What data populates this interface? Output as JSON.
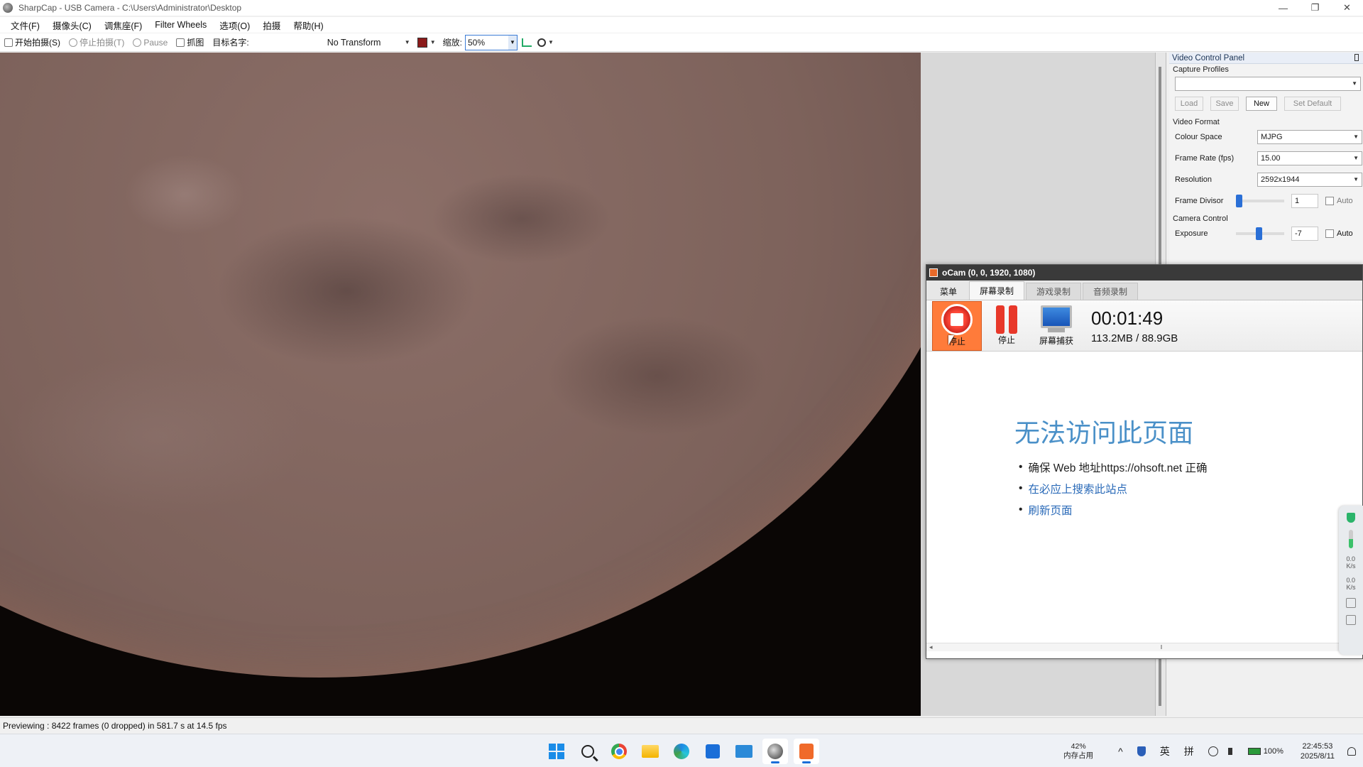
{
  "window": {
    "title": "SharpCap - USB Camera - C:\\Users\\Administrator\\Desktop",
    "controls": [
      "—",
      "❐",
      "✕"
    ]
  },
  "menu": [
    "文件(F)",
    "摄像头(C)",
    "调焦座(F)",
    "Filter Wheels",
    "选项(O)",
    "拍摄",
    "帮助(H)"
  ],
  "toolbar": {
    "start_capture": "开始拍摄(S)",
    "stop_capture": "停止拍摄(T)",
    "pause": "Pause",
    "snapshot": "抓图",
    "target_name": "目标名字:",
    "transform": "No Transform",
    "zoom_label": "缩放:",
    "zoom_value": "50%"
  },
  "video_control_panel": {
    "title": "Video Control Panel",
    "capture_profiles": "Capture Profiles",
    "profile_buttons": {
      "load": "Load",
      "save": "Save",
      "new": "New",
      "set_default": "Set Default"
    },
    "video_format": "Video Format",
    "colour_space": {
      "label": "Colour Space",
      "value": "MJPG"
    },
    "frame_rate": {
      "label": "Frame Rate (fps)",
      "value": "15.00"
    },
    "resolution": {
      "label": "Resolution",
      "value": "2592x1944"
    },
    "frame_divisor": {
      "label": "Frame Divisor",
      "value": "1",
      "auto": "Auto"
    },
    "camera_control": "Camera Control",
    "exposure": {
      "label": "Exposure",
      "value": "-7",
      "auto": "Auto"
    }
  },
  "ocam": {
    "title": "oCam (0, 0, 1920, 1080)",
    "tabs": [
      "菜单",
      "屏幕录制",
      "游戏录制",
      "音频录制"
    ],
    "record_button": "停止",
    "pause_button": "停止",
    "capture_button": "屏幕捕获",
    "timer": "00:01:49",
    "size": "113.2MB / 88.9GB",
    "error_title": "无法访问此页面",
    "error_items": [
      "确保 Web 地址https://ohsoft.net 正确",
      "在必应上搜索此站点",
      "刷新页面"
    ]
  },
  "side_widget": {
    "up": "0.0",
    "down": "0.0",
    "unit": "K/s"
  },
  "status": "Previewing : 8422 frames (0 dropped) in 581.7 s at 14.5 fps",
  "taskbar": {
    "memory_percent": "42%",
    "memory_label": "内存占用",
    "ime_lang": "英",
    "ime_mode": "拼",
    "battery": "100%",
    "time": "22:45:53",
    "date": "2025/8/11"
  }
}
